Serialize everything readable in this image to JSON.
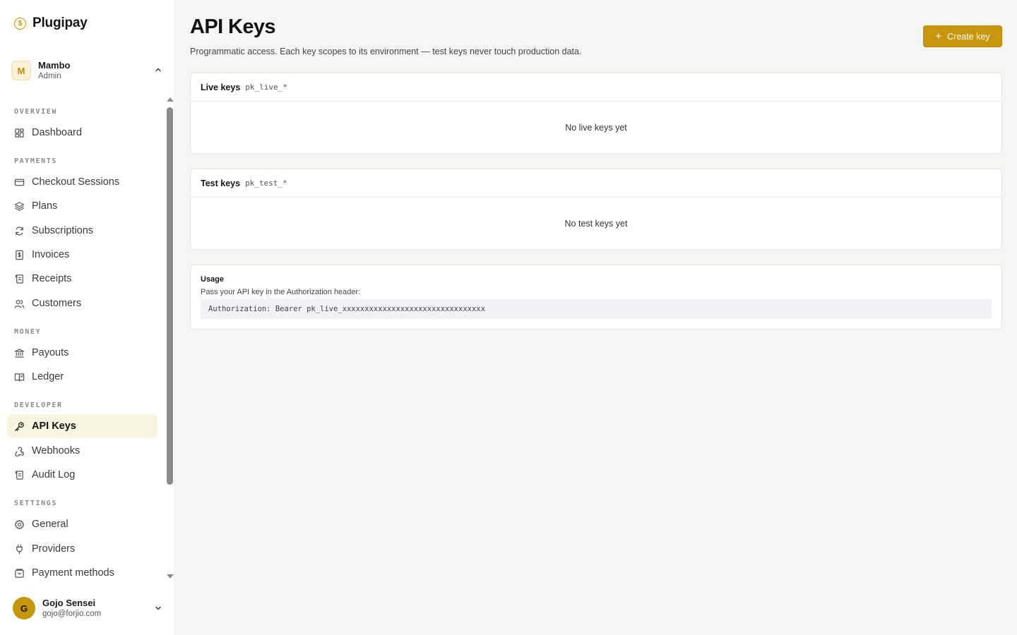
{
  "brand": {
    "name": "Plugipay",
    "logo_glyph": "$",
    "accent": "#c8960c"
  },
  "org": {
    "initial": "M",
    "name": "Mambo",
    "role": "Admin"
  },
  "nav": {
    "sections": [
      {
        "label": "OVERVIEW",
        "items": [
          {
            "label": "Dashboard",
            "icon": "dashboard-grid-icon"
          }
        ]
      },
      {
        "label": "PAYMENTS",
        "items": [
          {
            "label": "Checkout Sessions",
            "icon": "card-icon"
          },
          {
            "label": "Plans",
            "icon": "layers-icon"
          },
          {
            "label": "Subscriptions",
            "icon": "refresh-icon"
          },
          {
            "label": "Invoices",
            "icon": "invoice-dollar-icon"
          },
          {
            "label": "Receipts",
            "icon": "receipt-scroll-icon"
          },
          {
            "label": "Customers",
            "icon": "users-icon"
          }
        ]
      },
      {
        "label": "MONEY",
        "items": [
          {
            "label": "Payouts",
            "icon": "bank-icon"
          },
          {
            "label": "Ledger",
            "icon": "book-icon"
          }
        ]
      },
      {
        "label": "DEVELOPER",
        "items": [
          {
            "label": "API Keys",
            "icon": "key-icon",
            "active": true
          },
          {
            "label": "Webhooks",
            "icon": "webhook-icon"
          },
          {
            "label": "Audit Log",
            "icon": "scroll-icon"
          }
        ]
      },
      {
        "label": "SETTINGS",
        "items": [
          {
            "label": "General",
            "icon": "gear-icon"
          },
          {
            "label": "Providers",
            "icon": "plug-icon"
          },
          {
            "label": "Payment methods",
            "icon": "wallet-icon"
          }
        ]
      }
    ]
  },
  "user": {
    "initial": "G",
    "name": "Gojo Sensei",
    "email": "gojo@forjio.com"
  },
  "page": {
    "title": "API Keys",
    "subtitle": "Programmatic access. Each key scopes to its environment — test keys never touch production data.",
    "create_button": "Create key"
  },
  "live_keys": {
    "title": "Live keys",
    "prefix": "pk_live_*",
    "empty": "No live keys yet"
  },
  "test_keys": {
    "title": "Test keys",
    "prefix": "pk_test_*",
    "empty": "No test keys yet"
  },
  "usage": {
    "title": "Usage",
    "description": "Pass your API key in the Authorization header:",
    "code": "Authorization: Bearer pk_live_xxxxxxxxxxxxxxxxxxxxxxxxxxxxxxxx"
  }
}
